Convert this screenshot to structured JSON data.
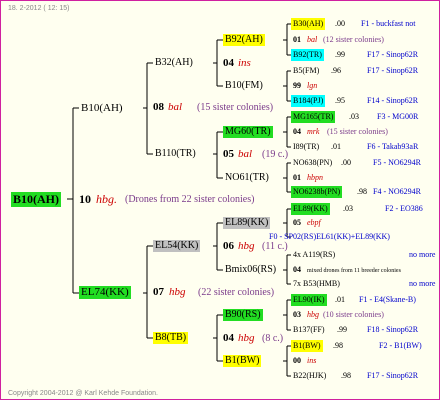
{
  "header": "18.  2-2012 ( 12: 15)",
  "footer": "Copyright 2004-2012 @ Karl Kehde Foundation.",
  "root": "B10(AH)",
  "root_gen": "10",
  "root_mark": "hbg.",
  "root_note": "(Drones from 22 sister colonies)",
  "g9a": "B10(AH)",
  "g9b": "EL74(KK)",
  "g8a": {
    "label": "08",
    "mark": "bal",
    "note": "(15 sister colonies)"
  },
  "g8b": {
    "label": "07",
    "mark": "hbg",
    "note": "(22 sister colonies)"
  },
  "g7": [
    "B32(AH)",
    "B110(TR)",
    "EL54(KK)",
    "B8(TB)"
  ],
  "g6": [
    {
      "label": "04",
      "mark": "ins",
      "note": ""
    },
    {
      "label": "05",
      "mark": "bal",
      "note": "(19 c.)"
    },
    {
      "label": "06",
      "mark": "hbg",
      "note": "(11 c.)"
    },
    {
      "label": "04",
      "mark": "hbg",
      "note": "(8 c.)"
    }
  ],
  "g5": [
    "B92(AH)",
    "B10(FM)",
    "MG60(TR)",
    "NO61(TR)",
    "EL89(KK)",
    "Bmix06(RS)",
    "B90(RS)",
    "B1(BW)"
  ],
  "rows": [
    {
      "n": "B30(AH)",
      "v": ".00",
      "r": "F1 - buckfast not"
    },
    {
      "n": "01",
      "m": "bal",
      "note": "(12 sister colonies)"
    },
    {
      "n": "B92(TR)",
      "v": ".99",
      "r": "F17 - Sinop62R"
    },
    {
      "n": "B5(FM)",
      "v": ".96",
      "r": "F17 - Sinop62R"
    },
    {
      "n": "99",
      "m": "lgn"
    },
    {
      "n": "B184(PJ)",
      "v": ".95",
      "r": "F14 - Sinop62R"
    },
    {
      "n": "MG165(TR)",
      "v": ".03",
      "r": "F3 - MG00R"
    },
    {
      "n": "04",
      "m": "mrk",
      "note": "(15 sister colonies)"
    },
    {
      "n": "I89(TR)",
      "v": ".01",
      "r": "F6 - Takab93aR"
    },
    {
      "n": "NO638(PN)",
      "v": ".00",
      "r": "F5 - NO6294R"
    },
    {
      "n": "01",
      "m": "hbpn"
    },
    {
      "n": "NO6238b(PN)",
      "v": ".98",
      "r": "F4 - NO6294R"
    },
    {
      "n": "EL89(KK)",
      "v": ".03",
      "r": "F2 - EO386"
    },
    {
      "n": "05",
      "m": "ebpf"
    },
    {
      "n": "F0 - SP02(RS)EL61(KK)+EL89(KK)"
    },
    {
      "n": "4x A119(RS)",
      "r": "no more"
    },
    {
      "n": "04",
      "note": "mixed drones from 11 breeder colonies"
    },
    {
      "n": "7x B53(HMB)",
      "r": "no more"
    },
    {
      "n": "EL90(IK)",
      "v": ".01",
      "r": "F1 - E4(Skane-B)"
    },
    {
      "n": "03",
      "m": "hbg",
      "note": "(10 sister colonies)"
    },
    {
      "n": "B137(FF)",
      "v": ".99",
      "r": "F18 - Sinop62R"
    },
    {
      "n": "B1(BW)",
      "v": ".98",
      "r": "F2 - B1(BW)"
    },
    {
      "n": "00",
      "m": "ins"
    },
    {
      "n": "B22(HJK)",
      "v": ".98",
      "r": "F17 - Sinop62R"
    }
  ]
}
